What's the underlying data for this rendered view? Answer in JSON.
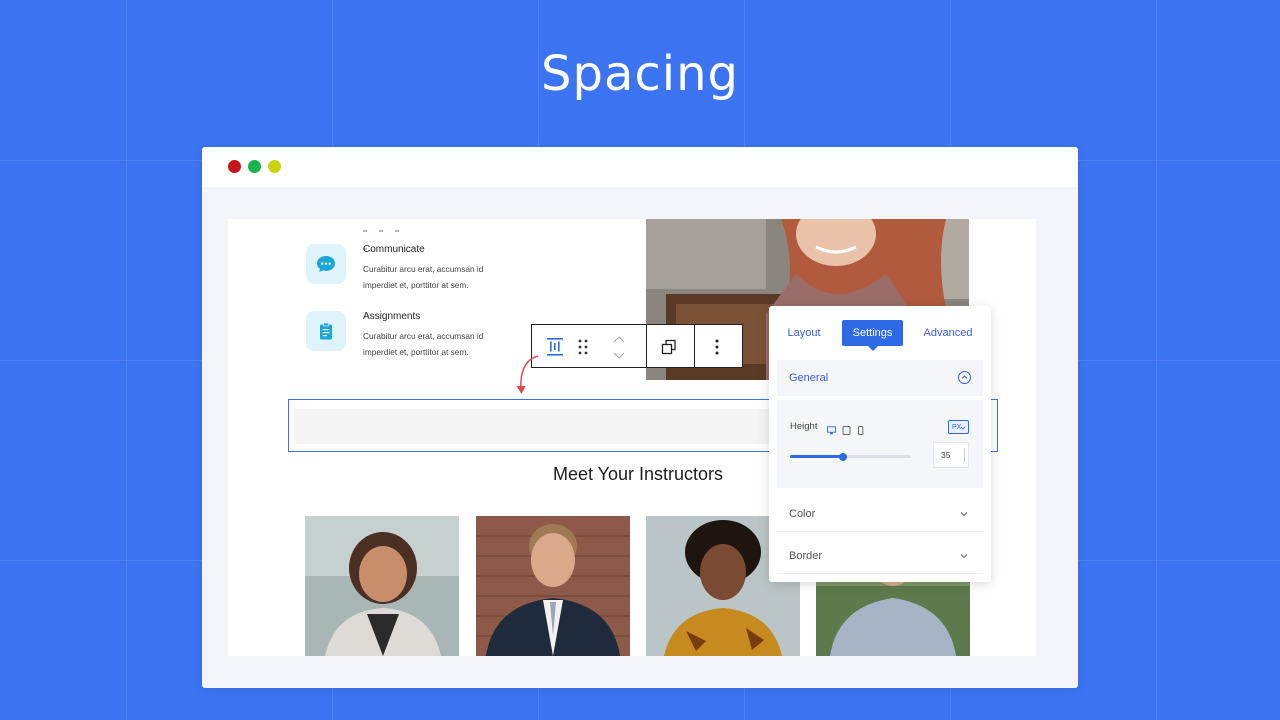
{
  "hero": {
    "title": "Spacing"
  },
  "features": [
    {
      "title": "Communicate",
      "desc": "Curabitur arcu erat, accumsan id imperdiet et, porttitor at sem.",
      "icon": "chat-bubble-icon"
    },
    {
      "title": "Assignments",
      "desc": "Curabitur arcu erat, accumsan id imperdiet et, porttitor at sem.",
      "icon": "clipboard-icon"
    }
  ],
  "section": {
    "title": "Meet Your Instructors"
  },
  "panel": {
    "tabs": {
      "layout": "Layout",
      "settings": "Settings",
      "advanced": "Advanced"
    },
    "general": {
      "title": "General",
      "height_label": "Height",
      "unit": "PX",
      "value": "35",
      "slider_level": 0.44
    },
    "color": {
      "title": "Color"
    },
    "border": {
      "title": "Border"
    }
  },
  "colors": {
    "accent": "#2e6ae6",
    "background": "#3b73f0",
    "arrow": "#e5484d"
  }
}
